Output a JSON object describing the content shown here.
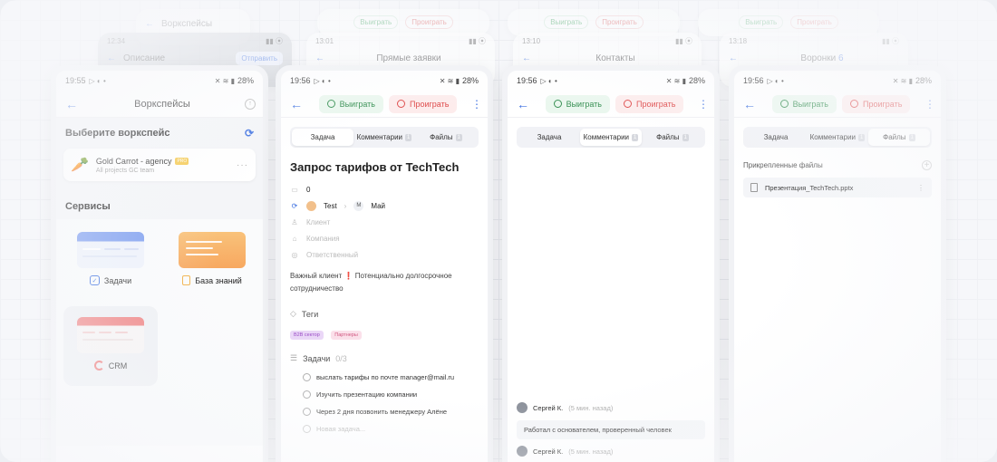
{
  "colors": {
    "accent": "#3b6fe0",
    "win": "#2e8b4b",
    "lose": "#dd4444"
  },
  "ghosts": [
    {
      "time": "",
      "title": "Воркспейсы"
    },
    {
      "time": "12:34",
      "title": "Описание",
      "send": "Отправить"
    },
    {
      "time": "13:01",
      "title": "Прямые заявки"
    },
    {
      "time": "13:10",
      "title": "Контакты",
      "win": "Выиграть",
      "lose": "Проиграть"
    },
    {
      "time": "13:18",
      "title": "Воронки",
      "count": "6",
      "win": "Выиграть",
      "lose": "Проиграть"
    }
  ],
  "status": {
    "time": "19:55",
    "time2": "19:56",
    "battery": "28%"
  },
  "phone1": {
    "title": "Воркспейсы",
    "choose": "Выберите воркспейс",
    "workspace": {
      "name": "Gold Carrot - agency",
      "badge": "PRO",
      "sub": "All projects GC team"
    },
    "services_title": "Сервисы",
    "services": [
      {
        "label": "Задачи",
        "icon": "check-icon"
      },
      {
        "label": "База знаний",
        "icon": "document-icon"
      },
      {
        "label": "CRM",
        "icon": "crm-icon"
      }
    ]
  },
  "actions": {
    "win": "Выиграть",
    "lose": "Проиграть"
  },
  "tabs": {
    "task": "Задача",
    "comments": "Комментарии",
    "files": "Файлы",
    "comments_count": "1",
    "files_count": "1"
  },
  "phone2": {
    "title": "Запрос тарифов от TechTech",
    "amount": "0",
    "user": "Test",
    "stage": "Май",
    "stage_initial": "M",
    "client": "Клиент",
    "company": "Компания",
    "responsible": "Ответственный",
    "desc_1": "Важный клиент",
    "desc_excl": "❗",
    "desc_2": "Потенциально долгосрочное сотрудничество",
    "tags_title": "Теги",
    "tags": [
      "B2B сектор",
      "Партнеры"
    ],
    "subtasks_title": "Задачи",
    "subtasks_count": "0/3",
    "subtasks": [
      "выслать тарифы по почте manager@mail.ru",
      "Изучить презентацию компании",
      "Через 2 дня позвонить менеджеру Алёне"
    ],
    "new_task": "Новая задача..."
  },
  "phone3": {
    "comments": [
      {
        "author": "Сергей К.",
        "time": "(5 мин. назад)",
        "text": "Работал с основателем, проверенный человек"
      },
      {
        "author": "Сергей К.",
        "time": "(5 мин. назад)",
        "text": ""
      }
    ]
  },
  "phone4": {
    "attached": "Прикрепленные файлы",
    "file": "Презентация_TechTech.pptx"
  }
}
